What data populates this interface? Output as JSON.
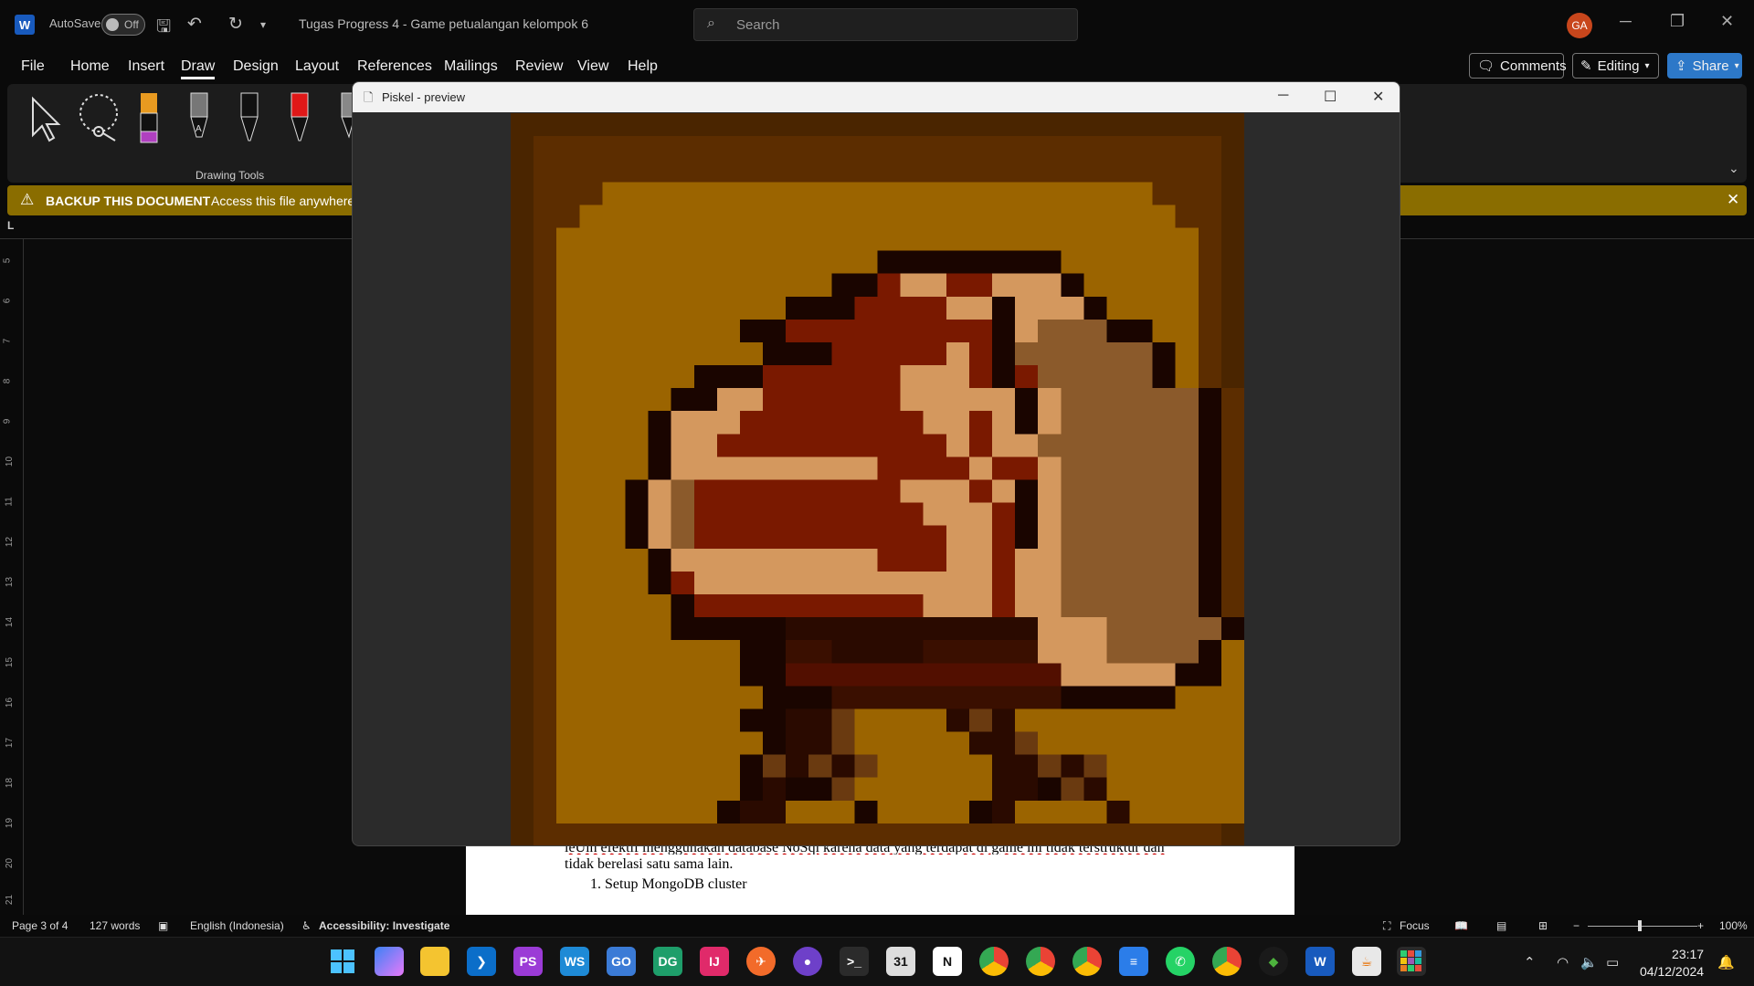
{
  "app": {
    "logo_letter": "W",
    "autosave_label": "AutoSave",
    "autosave_state": "Off",
    "document_title": "Tugas Progress 4 - Game petualangan kelompok 6",
    "search_placeholder": "Search",
    "user_initials": "GA"
  },
  "menu": {
    "items": [
      "File",
      "Home",
      "Insert",
      "Draw",
      "Design",
      "Layout",
      "References",
      "Mailings",
      "Review",
      "View",
      "Help"
    ],
    "active": "Draw",
    "comments_label": "Comments",
    "editing_label": "Editing",
    "share_label": "Share"
  },
  "ribbon": {
    "group_label": "Drawing Tools",
    "tools": [
      "select-tool",
      "lasso-tool",
      "highlighter-orange",
      "pencil-gray",
      "pen-black",
      "pen-red",
      "pen-gray"
    ]
  },
  "infobar": {
    "title": "BACKUP THIS DOCUMENT",
    "message": "Access this file anywhere"
  },
  "ruler": {
    "vertical_marks": [
      "5",
      "6",
      "7",
      "8",
      "9",
      "10",
      "11",
      "12",
      "13",
      "14",
      "15",
      "16",
      "17",
      "18",
      "19",
      "20",
      "21"
    ]
  },
  "document": {
    "line1": "ieUih efektif menggunakan database NoSql karena data yang terdapat di game ini tidak terstruktur dan",
    "line2": "tidak berelasi satu sama lain.",
    "list_item": "1.    Setup MongoDB cluster"
  },
  "status": {
    "page": "Page 3 of 4",
    "words": "127 words",
    "language": "English (Indonesia)",
    "accessibility": "Accessibility: Investigate",
    "focus": "Focus",
    "zoom": "100%"
  },
  "preview": {
    "title": "Piskel - preview",
    "palette": {
      "0": "#4a2500",
      "1": "#5c2d00",
      "2": "#9b6400",
      "3": "#1a0500",
      "4": "#7a1900",
      "5": "#d4985e",
      "6": "#8b5a2b",
      "7": "#3a0f00",
      "8": "#2a0a00",
      "9": "#520f00",
      "a": "#6a3a10"
    },
    "pixels": [
      "00000000000000000000000000000000",
      "01111111111111111111111111111110",
      "01111111111111111111111111111110",
      "01112222222222222222222222221110",
      "01122222222222222222222222222110",
      "01222222222222222222222222222210",
      "01222222222222223333333322222210",
      "01222222222222334554455532222210",
      "01222222222233344445535553222210",
      "01222222223344444444435666332210",
      "01222222222333444445436666663210",
      "01222222333444444555434666663210",
      "01222223355444444555553566666631",
      "01222235554444444455453566666631",
      "01222235544444444445455666666631",
      "01222235555555554444544566666631",
      "01222356444444444555453566666631",
      "01222356444444444455543566666631",
      "01222356444444444445543566666631",
      "01222235555555554445545566666631",
      "01222234555555555555545566666631",
      "01222223444444444455545566666631",
      "01222223333388888888888555666663",
      "01222222223377888877777555666632",
      "01222222223399999999999955555332",
      "01222222222333777777777733333222",
      "01222222223388a22228a82222222222",
      "01222222222388a2222288a222222222",
      "01222222223a8a8a2222288a8a222222",
      "01222222223833a222222883a8222222",
      "01222222238822232222382222822222",
      "01111111111111111111111111111110"
    ]
  }
}
